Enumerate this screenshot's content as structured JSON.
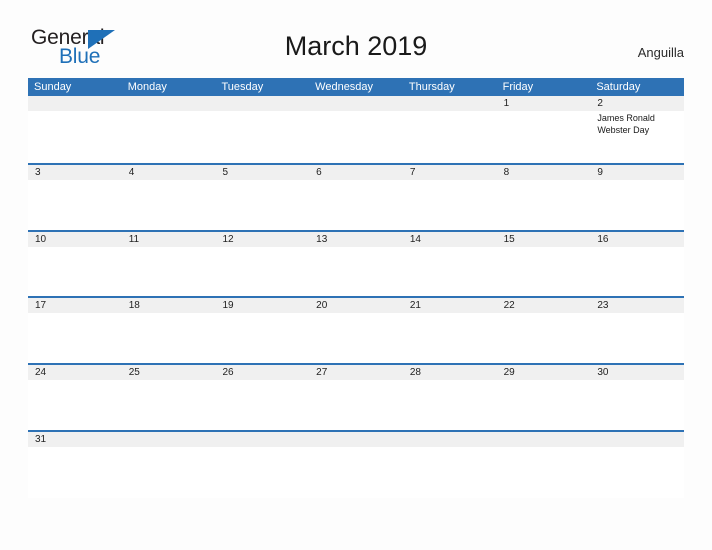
{
  "brand": {
    "name_part1": "General",
    "name_part2": "Blue",
    "flag_icon": "triangle-flag-icon",
    "color_primary": "#1f70b8",
    "color_text": "#231f20"
  },
  "header": {
    "title": "March 2019",
    "locale": "Anguilla"
  },
  "theme": {
    "header_blue": "#2e72b5",
    "separator_blue": "#2e72b5",
    "date_strip_gray": "#f0f0f0",
    "page_background": "#fdfdfd",
    "date_text": "#222222",
    "event_text": "#1a1a1a"
  },
  "calendar": {
    "month": "March",
    "year": "2019",
    "weekday_headers": [
      "Sunday",
      "Monday",
      "Tuesday",
      "Wednesday",
      "Thursday",
      "Friday",
      "Saturday"
    ],
    "weeks": [
      {
        "days": [
          {
            "date": "",
            "event": ""
          },
          {
            "date": "",
            "event": ""
          },
          {
            "date": "",
            "event": ""
          },
          {
            "date": "",
            "event": ""
          },
          {
            "date": "",
            "event": ""
          },
          {
            "date": "1",
            "event": ""
          },
          {
            "date": "2",
            "event": "James Ronald Webster Day"
          }
        ]
      },
      {
        "days": [
          {
            "date": "3",
            "event": ""
          },
          {
            "date": "4",
            "event": ""
          },
          {
            "date": "5",
            "event": ""
          },
          {
            "date": "6",
            "event": ""
          },
          {
            "date": "7",
            "event": ""
          },
          {
            "date": "8",
            "event": ""
          },
          {
            "date": "9",
            "event": ""
          }
        ]
      },
      {
        "days": [
          {
            "date": "10",
            "event": ""
          },
          {
            "date": "11",
            "event": ""
          },
          {
            "date": "12",
            "event": ""
          },
          {
            "date": "13",
            "event": ""
          },
          {
            "date": "14",
            "event": ""
          },
          {
            "date": "15",
            "event": ""
          },
          {
            "date": "16",
            "event": ""
          }
        ]
      },
      {
        "days": [
          {
            "date": "17",
            "event": ""
          },
          {
            "date": "18",
            "event": ""
          },
          {
            "date": "19",
            "event": ""
          },
          {
            "date": "20",
            "event": ""
          },
          {
            "date": "21",
            "event": ""
          },
          {
            "date": "22",
            "event": ""
          },
          {
            "date": "23",
            "event": ""
          }
        ]
      },
      {
        "days": [
          {
            "date": "24",
            "event": ""
          },
          {
            "date": "25",
            "event": ""
          },
          {
            "date": "26",
            "event": ""
          },
          {
            "date": "27",
            "event": ""
          },
          {
            "date": "28",
            "event": ""
          },
          {
            "date": "29",
            "event": ""
          },
          {
            "date": "30",
            "event": ""
          }
        ]
      },
      {
        "days": [
          {
            "date": "31",
            "event": ""
          },
          {
            "date": "",
            "event": ""
          },
          {
            "date": "",
            "event": ""
          },
          {
            "date": "",
            "event": ""
          },
          {
            "date": "",
            "event": ""
          },
          {
            "date": "",
            "event": ""
          },
          {
            "date": "",
            "event": ""
          }
        ]
      }
    ]
  }
}
